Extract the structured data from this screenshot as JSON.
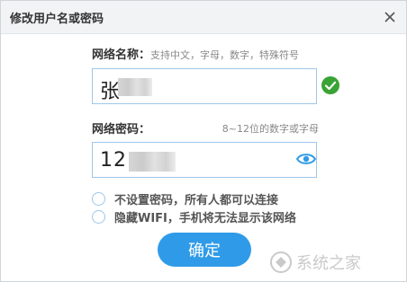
{
  "dialog": {
    "title": "修改用户名或密码",
    "close_icon": "close-icon"
  },
  "network_name": {
    "label": "网络名称：",
    "hint": "支持中文，字母，数字，特殊符号",
    "value_visible": "张",
    "status_icon": "check-circle-icon",
    "status_color": "#3aa335"
  },
  "network_password": {
    "label": "网络密码：",
    "hint": "8~12位的数字或字母",
    "value_visible": "12",
    "toggle_icon": "eye-icon",
    "accent_color": "#2f9be8"
  },
  "options": [
    {
      "label": "不设置密码，所有人都可以连接",
      "checked": false
    },
    {
      "label": "隐藏WIFI，手机将无法显示该网络",
      "checked": false
    }
  ],
  "confirm_button": {
    "label": "确定"
  },
  "watermark": {
    "icon": "system-logo-icon",
    "text": "系统之家"
  }
}
